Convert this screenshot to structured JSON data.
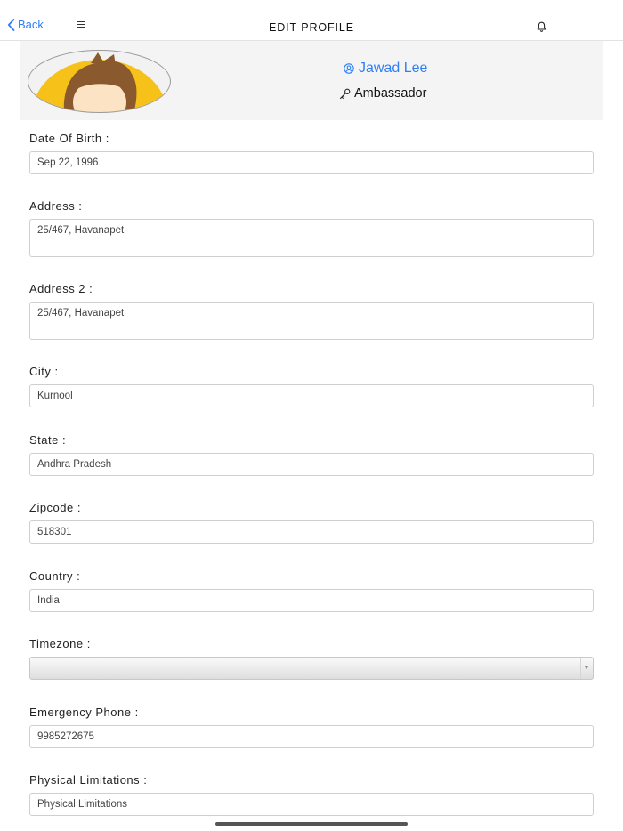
{
  "nav": {
    "back_label": "Back",
    "title": "EDIT PROFILE"
  },
  "profile": {
    "name": "Jawad Lee",
    "role": "Ambassador"
  },
  "form": {
    "dob_label": "Date Of Birth :",
    "dob_value": "Sep 22, 1996",
    "address_label": "Address :",
    "address_value": "25/467, Havanapet",
    "address2_label": "Address 2 :",
    "address2_value": "25/467, Havanapet",
    "city_label": "City :",
    "city_value": "Kurnool",
    "state_label": "State :",
    "state_value": "Andhra Pradesh",
    "zipcode_label": "Zipcode :",
    "zipcode_value": "518301",
    "country_label": "Country :",
    "country_value": "India",
    "timezone_label": "Timezone :",
    "timezone_value": "",
    "emergency_label": "Emergency Phone :",
    "emergency_value": "9985272675",
    "physical_label": "Physical Limitations :",
    "physical_value": "Physical Limitations"
  },
  "colors": {
    "accent": "#2f7ff7",
    "header_bg": "#f4f4f4",
    "avatar_hair": "#8a5a2e",
    "avatar_bg": "#f6c21a"
  }
}
